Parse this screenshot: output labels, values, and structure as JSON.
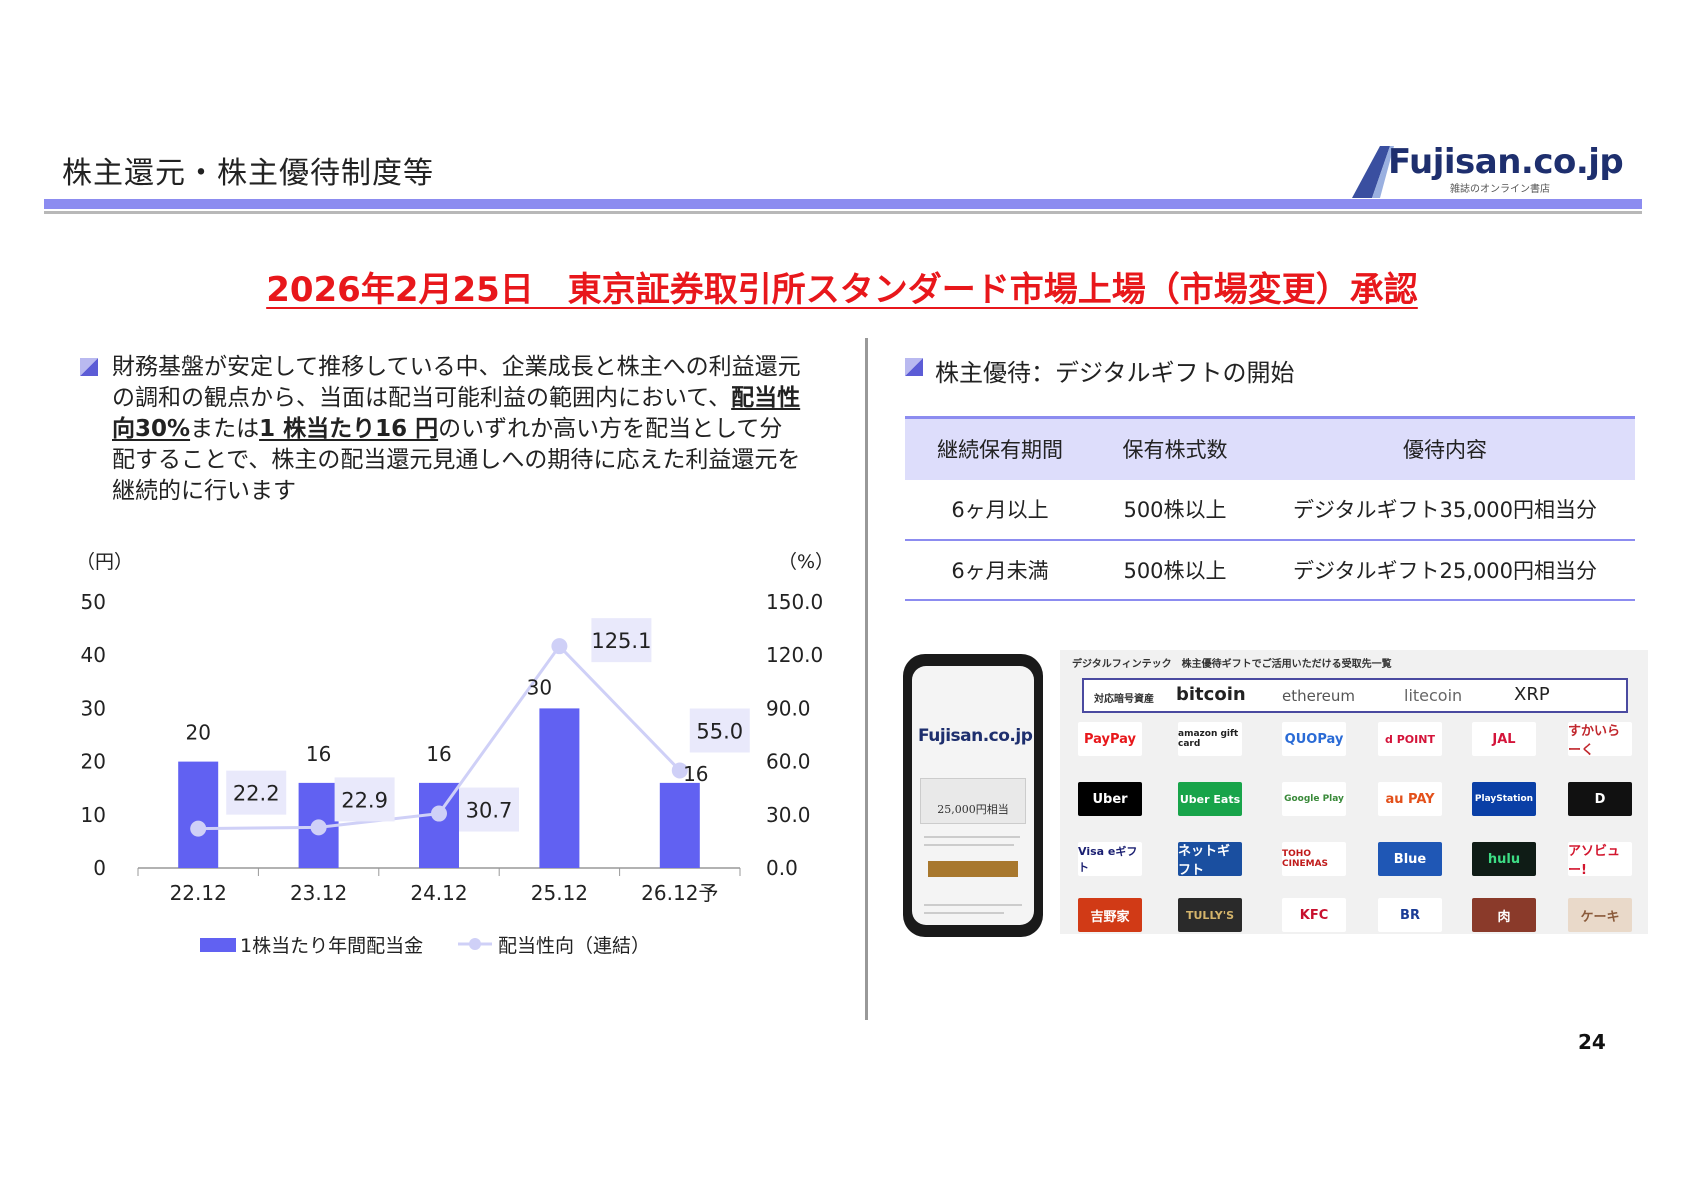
{
  "header": {
    "title": "株主還元・株主優待制度等",
    "logo_text": "Fujisan.co.jp",
    "logo_sub": "雑誌のオンライン書店"
  },
  "headline": "2026年2月25日　東京証券取引所スタンダード市場上場（市場変更）承認",
  "left": {
    "text_before": "財務基盤が安定して推移している中、企業成長と株主への利益還元の調和の観点から、当面は配当可能利益の範囲内において、",
    "bold1": "配当性向30%",
    "text_mid": "または",
    "bold2": "1 株当たり16 円",
    "text_after": "のいずれか高い方を配当として分配することで、株主の配当還元見通しへの期待に応えた利益還元を継続的に行います"
  },
  "chart_data": {
    "type": "bar",
    "categories": [
      "22.12",
      "23.12",
      "24.12",
      "25.12",
      "26.12予"
    ],
    "series": [
      {
        "name": "1株当たり年間配当金",
        "type": "bar",
        "axis": "left",
        "values": [
          20,
          16,
          16,
          30,
          16
        ],
        "color": "#6161f2"
      },
      {
        "name": "配当性向（連結）",
        "type": "line",
        "axis": "right",
        "values": [
          22.2,
          22.9,
          30.7,
          125.1,
          55.0
        ],
        "color": "#cfd0f7"
      }
    ],
    "y_left_label": "（円）",
    "y_right_label": "（%）",
    "y_left_ticks": [
      "0",
      "10",
      "20",
      "30",
      "40",
      "50"
    ],
    "y_right_ticks": [
      "0.0",
      "30.0",
      "60.0",
      "90.0",
      "120.0",
      "150.0"
    ],
    "ylim_left": [
      0,
      50
    ],
    "ylim_right": [
      0,
      150
    ],
    "bar_labels": [
      "20",
      "16",
      "16",
      "30",
      "16"
    ],
    "line_labels": [
      "22.2",
      "22.9",
      "30.7",
      "125.1",
      "55.0"
    ],
    "legend_position": "bottom"
  },
  "right": {
    "heading": "株主優待：デジタルギフトの開始",
    "table": {
      "headers": [
        "継続保有期間",
        "保有株式数",
        "優待内容"
      ],
      "rows": [
        [
          "6ヶ月以上",
          "500株以上",
          "デジタルギフト35,000円相当分"
        ],
        [
          "6ヶ月未満",
          "500株以上",
          "デジタルギフト25,000円相当分"
        ]
      ]
    },
    "phone": {
      "logo": "Fujisan.co.jp",
      "card_text": "25,000円相当"
    },
    "gift": {
      "title": "デジタルフィンテック　株主優待ギフトでご活用いただける受取先一覧",
      "crypto_label": "対応暗号資産",
      "crypto": [
        "bitcoin",
        "ethereum",
        "litecoin",
        "XRP"
      ],
      "tiles": [
        [
          "PayPay",
          "amazon gift card",
          "QUOPay",
          "d POINT",
          "JAL",
          "すかいらーく"
        ],
        [
          "Uber",
          "Uber Eats",
          "Google Play",
          "au PAY",
          "PlayStation",
          "D"
        ],
        [
          "Visa eギフト",
          "ネットギフト",
          "TOHO CINEMAS",
          "Blue",
          "hulu",
          "アソビュー!"
        ],
        [
          "吉野家",
          "TULLY'S",
          "KFC",
          "BR",
          "肉",
          "ケーキ"
        ]
      ]
    }
  },
  "page_number": "24",
  "colors": {
    "accent": "#6161f2",
    "headline": "#e8171b",
    "table_header": "#ddddfb"
  }
}
